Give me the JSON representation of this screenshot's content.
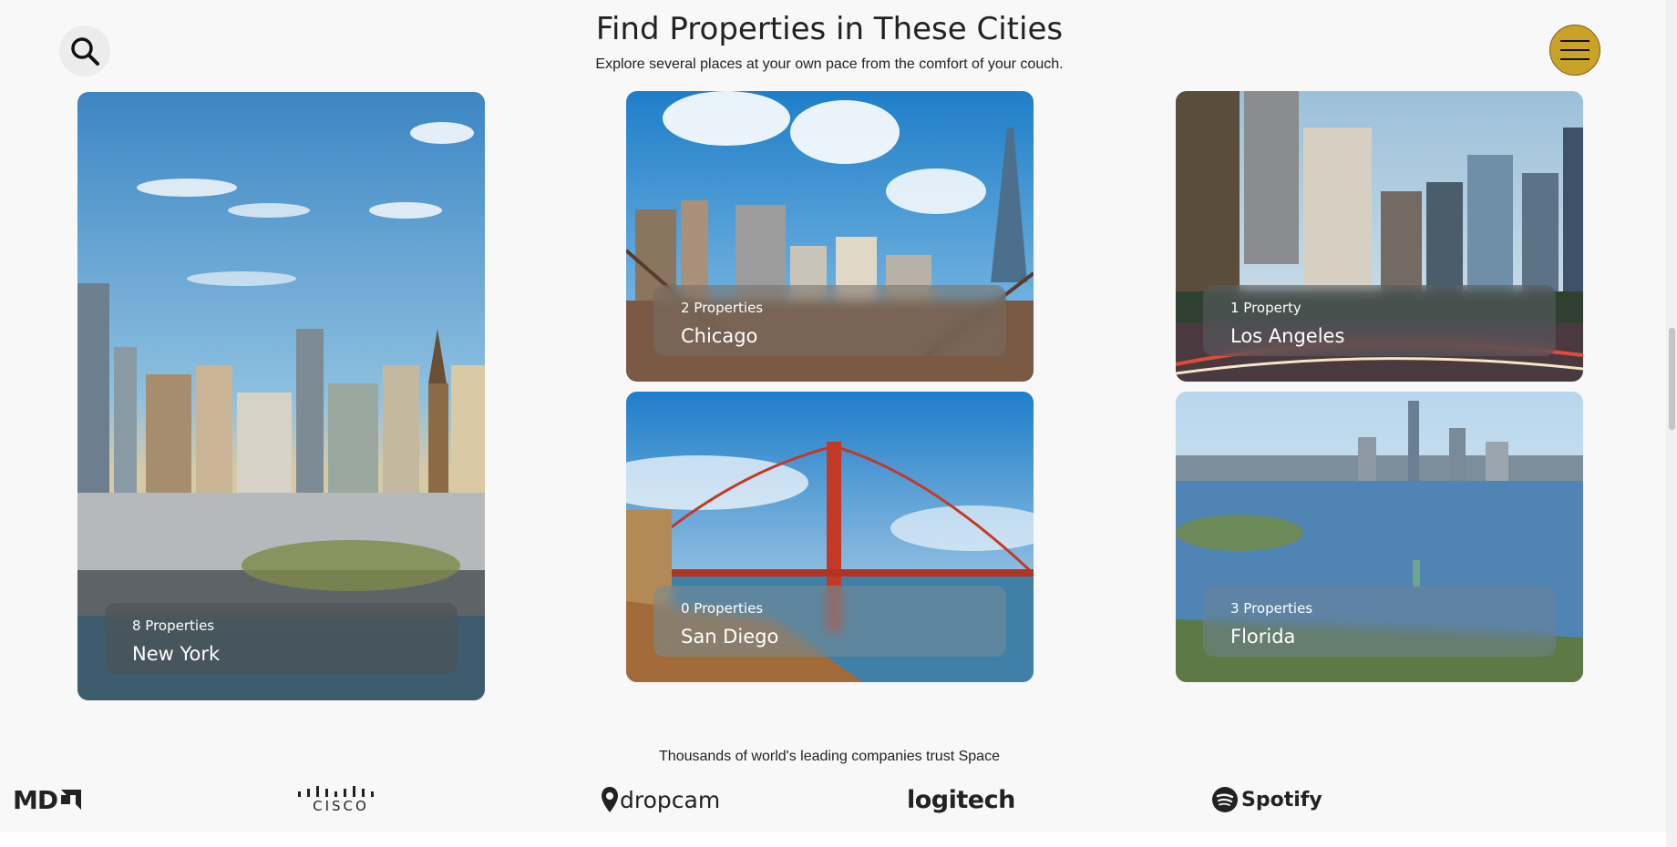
{
  "header": {
    "title": "Find Properties in These Cities",
    "subtitle": "Explore several places at your own pace from the comfort of your couch."
  },
  "icons": {
    "search": "search-icon",
    "menu": "hamburger-menu-icon"
  },
  "colors": {
    "menu_button": "#c9a227",
    "background": "#f8f8f8"
  },
  "cities": [
    {
      "count": "8 Properties",
      "name": "New York"
    },
    {
      "count": "2 Properties",
      "name": "Chicago"
    },
    {
      "count": "1 Property",
      "name": "Los Angeles"
    },
    {
      "count": "0 Properties",
      "name": "San Diego"
    },
    {
      "count": "3 Properties",
      "name": "Florida"
    }
  ],
  "trust": {
    "text": "Thousands of world's leading companies trust Space",
    "logos": [
      "MD",
      "cisco",
      "dropcam",
      "logitech",
      "Spotify"
    ]
  }
}
